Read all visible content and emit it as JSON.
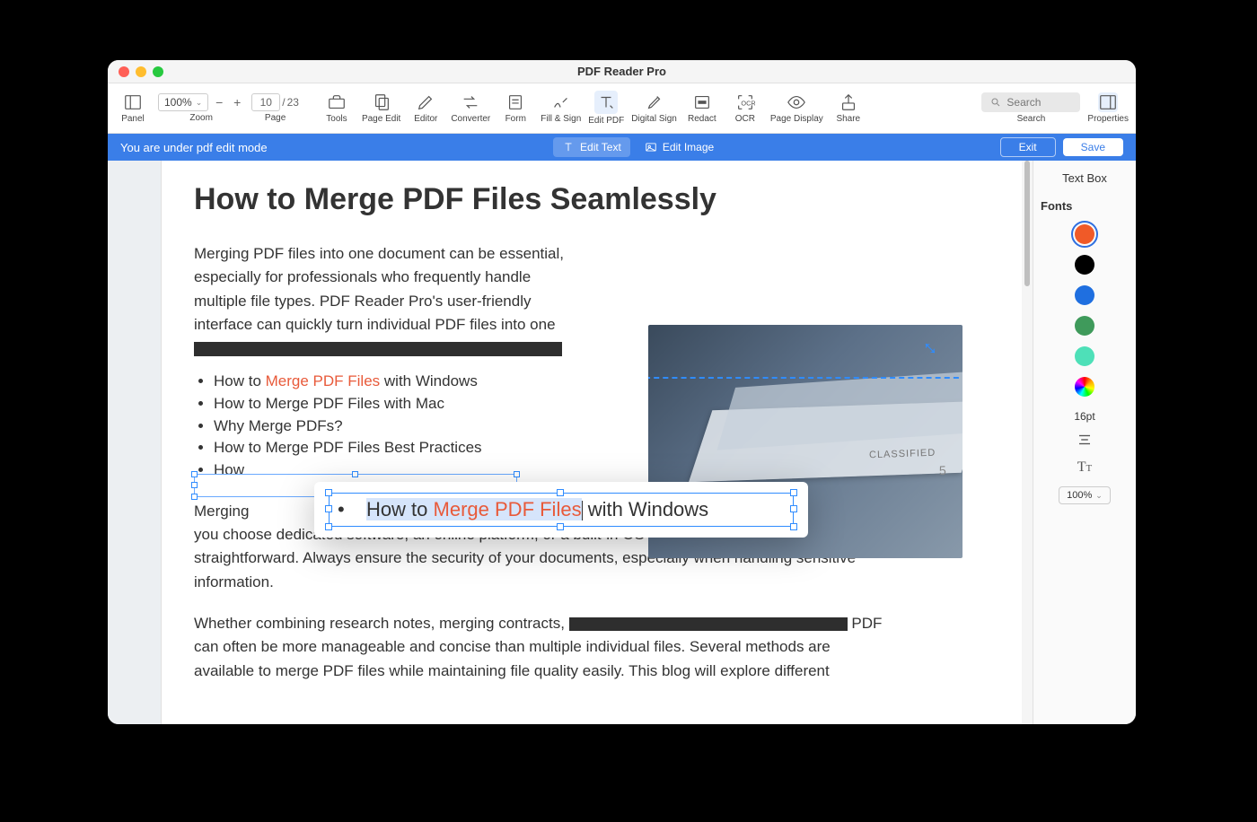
{
  "app": {
    "title": "PDF Reader Pro"
  },
  "toolbar": {
    "panel": "Panel",
    "zoom": {
      "label": "Zoom",
      "value": "100%"
    },
    "page": {
      "label": "Page",
      "current": "10",
      "total": "23"
    },
    "tools": "Tools",
    "page_edit": "Page Edit",
    "editor": "Editor",
    "converter": "Converter",
    "form": "Form",
    "fill_sign": "Fill & Sign",
    "edit_pdf": "Edit PDF",
    "digital_sign": "Digital Sign",
    "redact": "Redact",
    "ocr": "OCR",
    "page_display": "Page Display",
    "share": "Share",
    "search": {
      "label": "Search",
      "placeholder": "Search"
    },
    "properties": "Properties"
  },
  "editbar": {
    "mode_msg": "You are under pdf edit mode",
    "edit_text": "Edit Text",
    "edit_image": "Edit Image",
    "exit": "Exit",
    "save": "Save"
  },
  "props": {
    "title": "Text Box",
    "fonts_label": "Fonts",
    "colors": [
      "#f05a28",
      "#000000",
      "#1f6fe0",
      "#3f9a5b",
      "#4ee0b8",
      "rainbow"
    ],
    "selected_color": 0,
    "font_size": "16pt",
    "opacity": "100%"
  },
  "doc": {
    "h1": "How to Merge PDF Files Seamlessly",
    "lead": "Merging PDF files into one document can be essential, especially for professionals who frequently handle multiple file types. PDF Reader Pro's user-friendly interface can quickly turn individual PDF files into one",
    "list": [
      {
        "pre": "How to ",
        "hl": "Merge PDF Files",
        "post": " with Windows"
      },
      {
        "text": "How to Merge PDF Files with Mac"
      },
      {
        "text": "Why Merge PDFs?"
      },
      {
        "text": "How to Merge PDF Files Best Practices"
      },
      {
        "text": "How"
      }
    ],
    "para2_a": "Merging",
    "para2_b": "on. Whether you choose dedicated software, an online platform, or a built-in OS solution, merging PDFs is straightforward. Always ensure the security of your documents, especially when handling sensitive information.",
    "para3_a": "Whether combining research notes, merging contracts,",
    "para3_b": "PDF can often be more manageable and concise than multiple individual files. Several methods are available to merge PDF files while maintaining file quality easily. This blog will explore different",
    "img_label": "CLASSIFIED",
    "img_num": "5"
  },
  "popup": {
    "pre": "How to ",
    "hl": "Merge PDF Files",
    "post": " with Windows"
  }
}
